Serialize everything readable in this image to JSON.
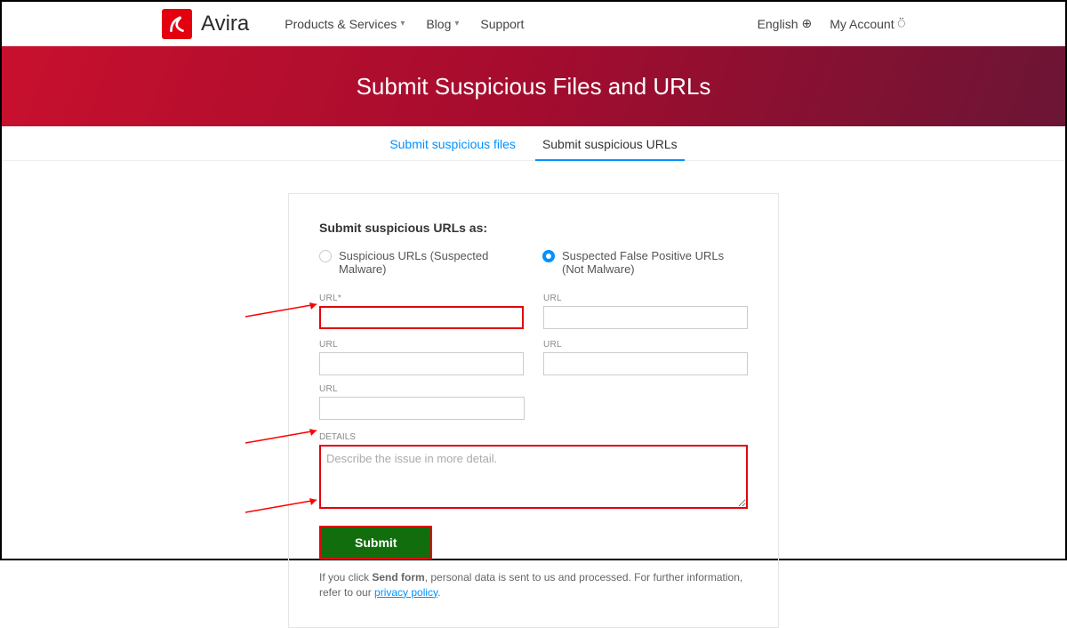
{
  "brand": "Avira",
  "nav": {
    "products": "Products & Services",
    "blog": "Blog",
    "support": "Support"
  },
  "right": {
    "language": "English",
    "account": "My Account"
  },
  "hero_title": "Submit Suspicious Files and URLs",
  "tabs": {
    "files": "Submit suspicious files",
    "urls": "Submit suspicious URLs"
  },
  "form": {
    "heading": "Submit suspicious URLs as:",
    "option1": "Suspicious URLs (Suspected Malware)",
    "option2": "Suspected False Positive URLs (Not Malware)",
    "url_req": "URL*",
    "url": "URL",
    "details_label": "DETAILS",
    "details_placeholder": "Describe the issue in more detail.",
    "submit": "Submit",
    "disclaimer_pre": "If you click ",
    "disclaimer_bold": "Send form",
    "disclaimer_mid": ", personal data is sent to us and processed. For further information, refer to our ",
    "disclaimer_link": "privacy policy",
    "disclaimer_end": "."
  }
}
